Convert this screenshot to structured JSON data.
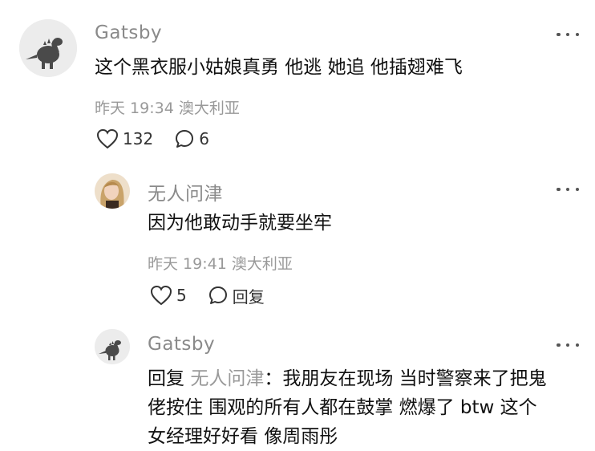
{
  "comments": [
    {
      "username": "Gatsby",
      "text": "这个黑衣服小姑娘真勇 他逃 她追 他插翅难飞",
      "time": "昨天 19:34",
      "location": "澳大利亚",
      "likes": "132",
      "replies": "6",
      "avatar_icon": "dinosaur-avatar"
    },
    {
      "username": "无人问津",
      "text": "因为他敢动手就要坐牢",
      "time": "昨天 19:41",
      "location": "澳大利亚",
      "likes": "5",
      "reply_label": "回复",
      "avatar_icon": "person-avatar"
    },
    {
      "username": "Gatsby",
      "reply_prefix": "回复",
      "reply_target": "无人问津",
      "reply_separator": "：",
      "text_line1": "我朋友在现场 当时警察来了把鬼",
      "text_line2": "佬按住 围观的所有人都在鼓掌 燃爆了 btw 这个",
      "text_line3": "女经理好好看 像周雨彤",
      "avatar_icon": "dinosaur-avatar"
    }
  ],
  "colors": {
    "username": "#8a8a8a",
    "meta": "#999999",
    "text": "#111111",
    "icon": "#333333"
  }
}
